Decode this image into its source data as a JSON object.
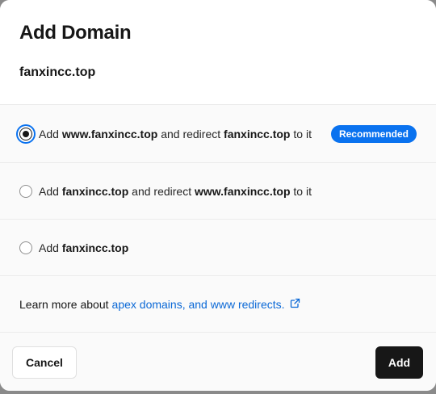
{
  "dialog": {
    "title": "Add Domain",
    "domain": "fanxincc.top"
  },
  "options": [
    {
      "selected": true,
      "prefix": "Add ",
      "primary": "www.fanxincc.top",
      "middle": " and redirect ",
      "secondary": "fanxincc.top",
      "suffix": " to it",
      "badge": "Recommended"
    },
    {
      "selected": false,
      "prefix": "Add ",
      "primary": "fanxincc.top",
      "middle": " and redirect ",
      "secondary": "www.fanxincc.top",
      "suffix": " to it"
    },
    {
      "selected": false,
      "prefix": "Add ",
      "primary": "fanxincc.top"
    }
  ],
  "learn_more": {
    "text": "Learn more about",
    "link": "apex domains, and www redirects.",
    "icon": "external-link-icon"
  },
  "footer": {
    "cancel_label": "Cancel",
    "add_label": "Add"
  },
  "colors": {
    "accent": "#0a72ef",
    "primary_button": "#171717"
  }
}
